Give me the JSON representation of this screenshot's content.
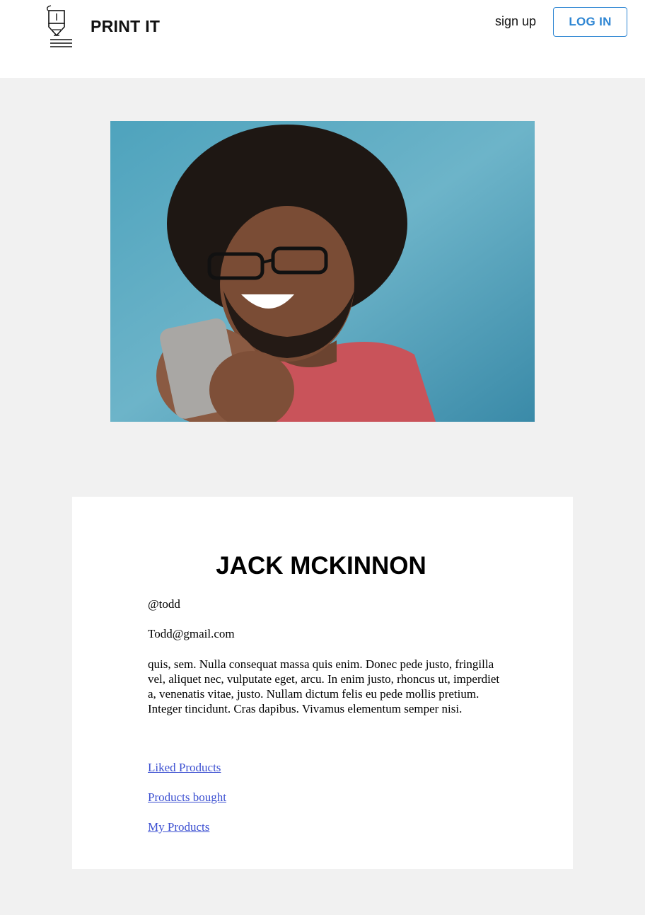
{
  "header": {
    "brand": "PRINT IT",
    "logo_icon": "3d-printer-nozzle-icon",
    "signup_label": "sign up",
    "login_label": "LOG IN",
    "accent_color": "#2f86d3"
  },
  "profile": {
    "photo": "profile-photo",
    "name": "JACK MCKINNON",
    "handle": "@todd",
    "email": "Todd@gmail.com",
    "bio": "quis, sem. Nulla consequat massa quis enim. Donec pede justo, fringilla vel, aliquet nec, vulputate eget, arcu. In enim justo, rhoncus ut, imperdiet a, venenatis vitae, justo. Nullam dictum felis eu pede mollis pretium. Integer tincidunt. Cras dapibus. Vivamus elementum semper nisi.",
    "links": [
      "Liked Products",
      "Products bought",
      "My Products"
    ]
  }
}
